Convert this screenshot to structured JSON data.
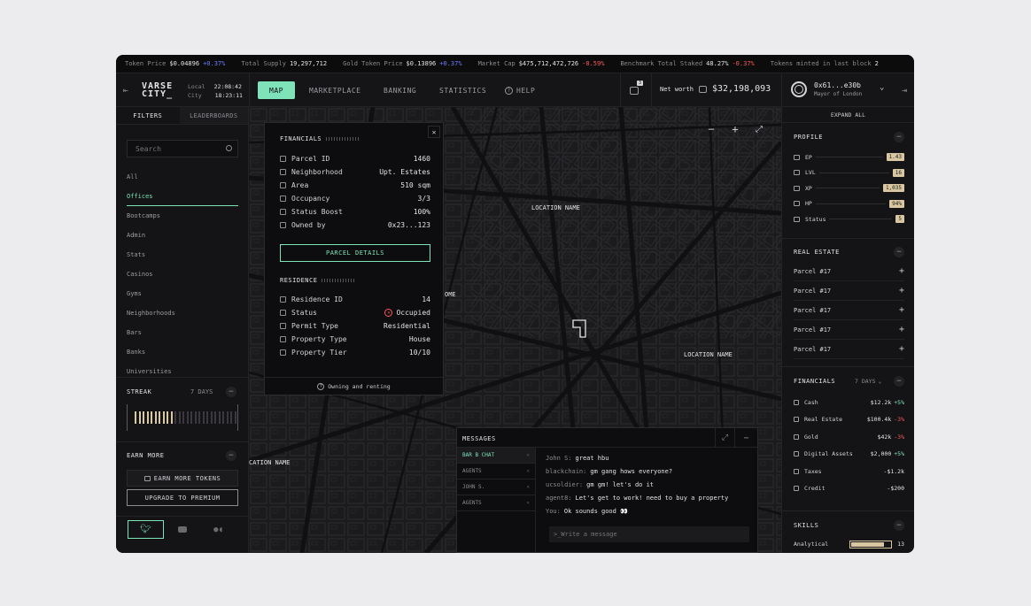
{
  "ticker": [
    {
      "label": "Token Price",
      "value": "$0.04896",
      "change": "+0.37%",
      "dir": "up"
    },
    {
      "label": "Total Supply",
      "value": "19,297,712",
      "change": "",
      "dir": ""
    },
    {
      "label": "Gold Token Price",
      "value": "$0.13896",
      "change": "+0.37%",
      "dir": "up"
    },
    {
      "label": "Market Cap",
      "value": "$475,712,472,726",
      "change": "-0.59%",
      "dir": "dn"
    },
    {
      "label": "Benchmark Total Staked",
      "value": "48.27%",
      "change": "-0.37%",
      "dir": "dn"
    },
    {
      "label": "Tokens minted in last block",
      "value": "2",
      "change": "",
      "dir": ""
    }
  ],
  "brand": {
    "logo": "VARSE CITY_",
    "local_label": "Local",
    "local_time": "22:08:42",
    "city_label": "City",
    "city_time": "18:23:11"
  },
  "nav": {
    "tabs": [
      "MAP",
      "MARKETPLACE",
      "BANKING",
      "STATISTICS"
    ],
    "help": "HELP",
    "active": "MAP"
  },
  "header": {
    "notif_count": "3",
    "net_worth_label": "Net worth",
    "net_worth_value": "$32,198,093",
    "user_addr": "0x61...e30b",
    "user_title": "Mayor of London"
  },
  "sidebar": {
    "tabs": [
      "FILTERS",
      "LEADERBOARDS"
    ],
    "search_placeholder": "Search",
    "filters": [
      "All",
      "Offices",
      "Bootcamps",
      "Admin",
      "Stats",
      "Casinos",
      "Gyms",
      "Neighborhoods",
      "Bars",
      "Banks",
      "Universities"
    ],
    "active_filter": "Offices",
    "streak_label": "STREAK",
    "streak_days": "7 DAYS",
    "earn_label": "EARN MORE",
    "earn_button": "EARN MORE TOKENS",
    "premium_button": "UPGRADE TO PREMIUM"
  },
  "popup": {
    "financials_title": "FINANCIALS",
    "financials": [
      {
        "icon": "parcel-icon",
        "label": "Parcel ID",
        "value": "1460"
      },
      {
        "icon": "neighborhood-icon",
        "label": "Neighborhood",
        "value": "Upt. Estates"
      },
      {
        "icon": "area-icon",
        "label": "Area",
        "value": "510 sqm"
      },
      {
        "icon": "occupancy-icon",
        "label": "Occupancy",
        "value": "3/3"
      },
      {
        "icon": "boost-icon",
        "label": "Status Boost",
        "value": "100%"
      },
      {
        "icon": "owner-icon",
        "label": "Owned by",
        "value": "0x23...123"
      }
    ],
    "parcel_button": "PARCEL DETAILS",
    "residence_title": "RESIDENCE",
    "residence": [
      {
        "icon": "parcel-icon",
        "label": "Residence ID",
        "value": "14"
      },
      {
        "icon": "eye-icon",
        "label": "Status",
        "value": "Occupied"
      },
      {
        "icon": "permit-icon",
        "label": "Permit Type",
        "value": "Residential"
      },
      {
        "icon": "house-icon",
        "label": "Property Type",
        "value": "House"
      },
      {
        "icon": "tier-icon",
        "label": "Property Tier",
        "value": "10/10"
      }
    ],
    "footer": "Owning and renting"
  },
  "map_labels": {
    "loc1": "LOCATION NAME",
    "loc2": "LOCATION NAME",
    "loc3": "CATION NAME",
    "loc4": "OME"
  },
  "messages": {
    "title": "MESSAGES",
    "channels": [
      "BAR B CHAT",
      "AGENTS",
      "JOHN S.",
      "AGENTS"
    ],
    "active_channel": "BAR B CHAT",
    "chat": [
      {
        "user": "John S:",
        "text": "great hbu"
      },
      {
        "user": "blackchain:",
        "text": "gm gang hows everyone?"
      },
      {
        "user": "ucsoldier:",
        "text": "gm gm! let's do it"
      },
      {
        "user": "agent8:",
        "text": "Let's get to work! need to buy a property"
      },
      {
        "user": "You:",
        "text": "Ok sounds good 👀"
      }
    ],
    "input_placeholder": ">_Write a message"
  },
  "right": {
    "expand_all": "EXPAND ALL",
    "profile_title": "PROFILE",
    "profile": [
      {
        "icon": "ep-icon",
        "label": "EP",
        "value": "1.43"
      },
      {
        "icon": "lvl-icon",
        "label": "LVL",
        "value": "16"
      },
      {
        "icon": "xp-icon",
        "label": "XP",
        "value": "1,035"
      },
      {
        "icon": "hp-icon",
        "label": "HP",
        "value": "94%"
      },
      {
        "icon": "status-icon",
        "label": "Status",
        "value": "5"
      }
    ],
    "real_estate_title": "REAL ESTATE",
    "parcels": [
      "Parcel #17",
      "Parcel #17",
      "Parcel #17",
      "Parcel #17",
      "Parcel #17"
    ],
    "financials_title": "FINANCIALS",
    "financials_period": "7 DAYS",
    "financials": [
      {
        "icon": "cash-icon",
        "label": "Cash",
        "value": "$12.2k",
        "change": "+5%",
        "dir": "up"
      },
      {
        "icon": "realestate-icon",
        "label": "Real Estate",
        "value": "$100.4k",
        "change": "-3%",
        "dir": "dn"
      },
      {
        "icon": "gold-icon",
        "label": "Gold",
        "value": "$42k",
        "change": "-3%",
        "dir": "dn"
      },
      {
        "icon": "digital-icon",
        "label": "Digital Assets",
        "value": "$2,000",
        "change": "+5%",
        "dir": "up"
      },
      {
        "icon": "taxes-icon",
        "label": "Taxes",
        "value": "-$1.2k",
        "change": "",
        "dir": ""
      },
      {
        "icon": "credit-icon",
        "label": "Credit",
        "value": "-$200",
        "change": "",
        "dir": ""
      }
    ],
    "skills_title": "SKILLS",
    "skills": [
      {
        "label": "Analytical",
        "value": "13",
        "level": 0.85
      }
    ]
  },
  "colors": {
    "accent": "#7fe3b9",
    "up": "#6b7bff",
    "down": "#ff5a5a",
    "badge": "#d8c7a0",
    "bg": "#131315"
  }
}
